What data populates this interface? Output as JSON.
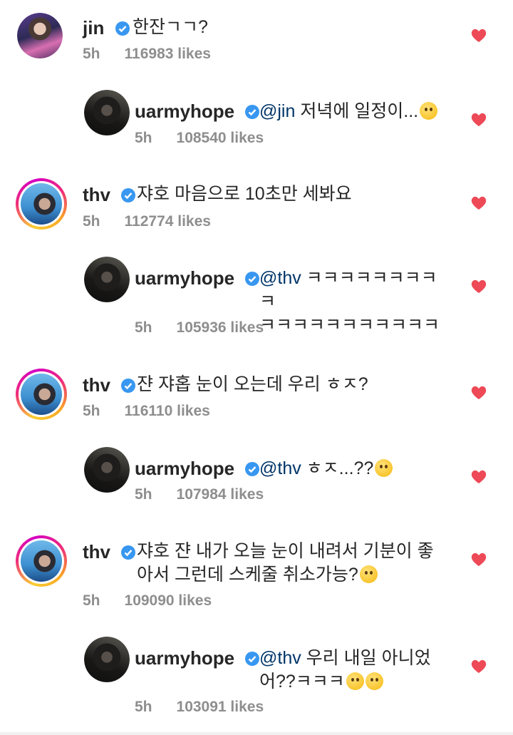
{
  "comments": [
    {
      "user": "jin",
      "mention": "",
      "text": "한잔ㄱㄱ?",
      "emoji": "",
      "time": "5h",
      "likes": "116983 likes"
    },
    {
      "user": "uarmyhope",
      "mention": "@jin",
      "text": " 저녁에 일정이...",
      "emoji": "grinning-sweat-emoji",
      "time": "5h",
      "likes": "108540 likes"
    },
    {
      "user": "thv",
      "mention": "",
      "text": "쟈호 마음으로 10초만 세봐요",
      "emoji": "",
      "time": "5h",
      "likes": "112774 likes"
    },
    {
      "user": "uarmyhope",
      "mention": "@thv",
      "text": " ㅋㅋㅋㅋㅋㅋㅋㅋㅋ\nㅋㅋㅋㅋㅋㅋㅋㅋㅋㅋㅋ",
      "emoji": "",
      "time": "5h",
      "likes": "105936 likes"
    },
    {
      "user": "thv",
      "mention": "",
      "text": "쟌 쟈홉 눈이 오는데 우리 ㅎㅈ?",
      "emoji": "",
      "time": "5h",
      "likes": "116110 likes"
    },
    {
      "user": "uarmyhope",
      "mention": "@thv",
      "text": " ㅎㅈ...??",
      "emoji": "surprised-emoji",
      "time": "5h",
      "likes": "107984 likes"
    },
    {
      "user": "thv",
      "mention": "",
      "text": "쟈호 쟌 내가 오늘 눈이 내려서 기분이 좋\n아서 그런데 스케줄 취소가능?",
      "emoji": "heart-eyes-emoji",
      "time": "5h",
      "likes": "109090 likes"
    },
    {
      "user": "uarmyhope",
      "mention": "@thv",
      "text": " 우리 내일 아니었\n어??ㅋㅋㅋ",
      "emoji": "crying-surprised-emoji",
      "time": "5h",
      "likes": "103091 likes"
    }
  ],
  "colors": {
    "heart": "#ed4956",
    "verified": "#3897f0",
    "mention": "#003569",
    "meta": "#8e8e8e"
  }
}
